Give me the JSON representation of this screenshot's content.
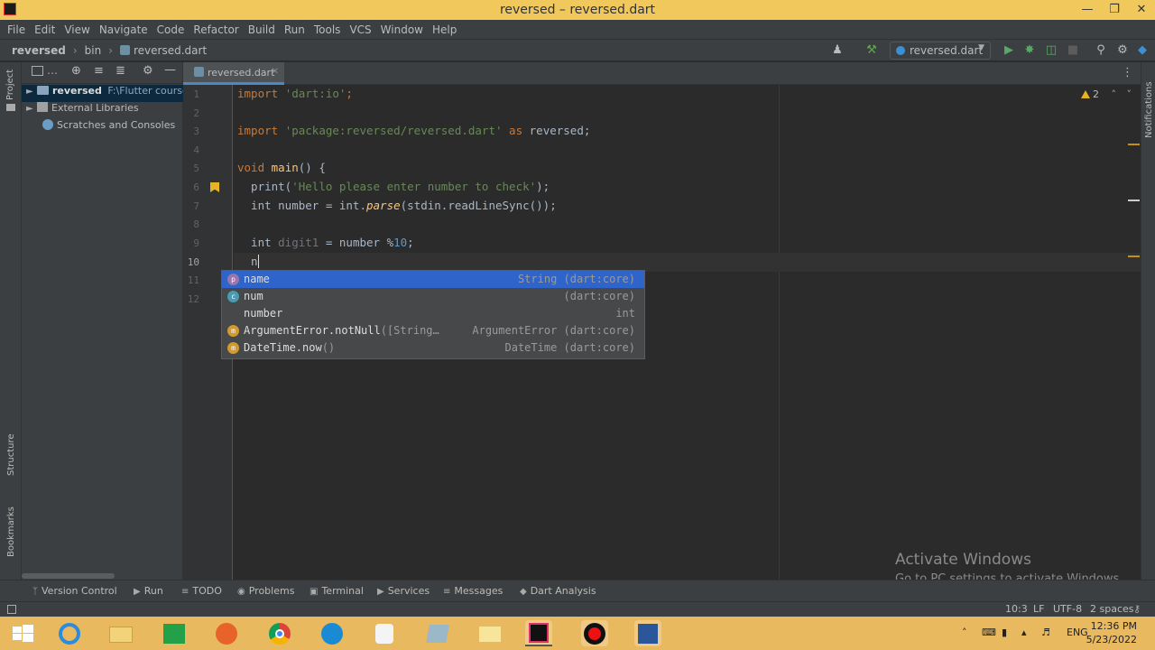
{
  "window": {
    "title": "reversed – reversed.dart"
  },
  "menu": [
    "File",
    "Edit",
    "View",
    "Navigate",
    "Code",
    "Refactor",
    "Build",
    "Run",
    "Tools",
    "VCS",
    "Window",
    "Help"
  ],
  "breadcrumbs": [
    "reversed",
    "bin",
    "reversed.dart"
  ],
  "run_config": "reversed.dart",
  "left_stripe": {
    "project": "Project",
    "structure": "Structure",
    "bookmarks": "Bookmarks"
  },
  "right_stripe": {
    "notifications": "Notifications"
  },
  "project_tree": [
    {
      "label": "reversed",
      "path": "F:\\Flutter course-",
      "selected": true
    },
    {
      "label": "External Libraries"
    },
    {
      "label": "Scratches and Consoles"
    }
  ],
  "editor_tab": "reversed.dart",
  "line_numbers": [
    "1",
    "2",
    "3",
    "4",
    "5",
    "6",
    "7",
    "8",
    "9",
    "10",
    "11",
    "12"
  ],
  "code_lines": {
    "l1_kw": "import",
    "l1_str": "'dart:io'",
    "l1_end": ";",
    "l3_kw": "import",
    "l3_str": "'package:reversed/reversed.dart'",
    "l3_as": "as",
    "l3_name": "reversed;",
    "l5_kw": "void",
    "l5_fn": "main",
    "l5_rest": "() {",
    "l6_a": "  print(",
    "l6_str": "'Hello please enter number to check'",
    "l6_b": ");",
    "l7_a": "  int number = int.",
    "l7_fn": "parse",
    "l7_b": "(stdin.readLineSync());",
    "l9_a": "  int ",
    "l9_var": "digit1",
    "l9_b": " = number %",
    "l9_num": "10",
    "l9_c": ";",
    "l10_text": "  n"
  },
  "completion": [
    {
      "icon": "p",
      "label": "name",
      "tail": "",
      "right": "String (dart:core)",
      "icon_color": "#9876aa"
    },
    {
      "icon": "c",
      "label": "num",
      "tail": "",
      "right": "(dart:core)",
      "icon_color": "#4a9ab2"
    },
    {
      "icon": "",
      "label": "number",
      "tail": "",
      "right": "int",
      "icon_color": ""
    },
    {
      "icon": "m",
      "label": "ArgumentError.notNull",
      "tail": "([String…",
      "right": "ArgumentError (dart:core)",
      "icon_color": "#d19a2f"
    },
    {
      "icon": "m",
      "label": "DateTime.now",
      "tail": "()",
      "right": "DateTime (dart:core)",
      "icon_color": "#d19a2f"
    }
  ],
  "inspection": {
    "warnings": "2"
  },
  "watermark": {
    "line1": "Activate Windows",
    "line2": "Go to PC settings to activate Windows."
  },
  "tool_windows": [
    "Version Control",
    "Run",
    "TODO",
    "Problems",
    "Terminal",
    "Services",
    "Messages",
    "Dart Analysis"
  ],
  "status": {
    "position": "10:3",
    "line_sep": "LF",
    "encoding": "UTF-8",
    "indent": "2 spaces"
  },
  "taskbar": {
    "lang": "ENG",
    "time": "12:36 PM",
    "date": "5/23/2022"
  },
  "colors": {
    "accent": "#4a88c7",
    "selection": "#2f65ca",
    "taskbar": "#e8b95e"
  }
}
